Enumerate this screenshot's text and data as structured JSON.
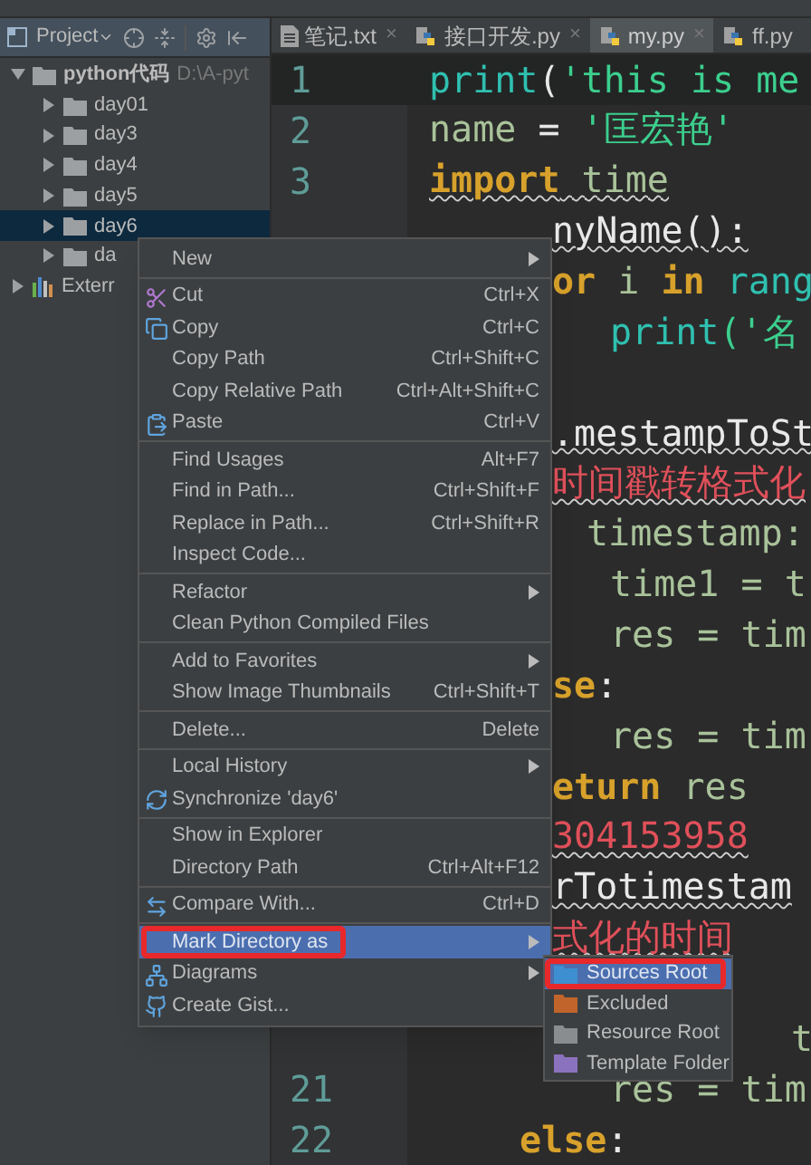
{
  "project_panel": {
    "title": "Project"
  },
  "tree": [
    {
      "label": "python代码",
      "path": "D:\\A-pyt",
      "expanded": true,
      "selected": false,
      "children": [
        {
          "label": "day01",
          "expanded": false,
          "selected": false
        },
        {
          "label": "day3",
          "expanded": false,
          "selected": false
        },
        {
          "label": "day4",
          "expanded": false,
          "selected": false
        },
        {
          "label": "day5",
          "expanded": false,
          "selected": false
        },
        {
          "label": "day6",
          "expanded": false,
          "selected": true
        },
        {
          "label": "da",
          "expanded": false,
          "selected": false
        }
      ]
    },
    {
      "label": "Exterr",
      "expanded": false,
      "selected": false,
      "kind": "libraries"
    }
  ],
  "tabs": [
    {
      "label": "笔记.txt",
      "close": "×",
      "selected": false,
      "kind": "text"
    },
    {
      "label": "接口开发.py",
      "close": "×",
      "selected": false,
      "kind": "python"
    },
    {
      "label": "my.py",
      "close": "×",
      "selected": true,
      "kind": "python"
    },
    {
      "label": "ff.py",
      "selected": false,
      "kind": "python"
    }
  ],
  "editor": {
    "lines": [
      {
        "number": "1",
        "squiggle": false,
        "segments": [
          {
            "text": "print",
            "kind": "fn"
          },
          {
            "text": "(",
            "kind": "op"
          },
          {
            "text": "'this is me",
            "kind": "str"
          }
        ]
      },
      {
        "number": "2",
        "squiggle": false,
        "segments": [
          {
            "text": "name ",
            "kind": "id"
          },
          {
            "text": "= ",
            "kind": "op"
          },
          {
            "text": "'匡宏艳'",
            "kind": "str"
          }
        ]
      },
      {
        "number": "3",
        "squiggle": true,
        "segments": [
          {
            "text": "import",
            "kind": "kw"
          },
          {
            "text": " time",
            "kind": "id"
          }
        ]
      },
      {
        "squiggle": true,
        "segments": [
          {
            "text": "nyName():",
            "kind": "op"
          }
        ]
      },
      {
        "squiggle": false,
        "segments": [
          {
            "text": "or ",
            "kind": "kw"
          },
          {
            "text": "i ",
            "kind": "id"
          },
          {
            "text": "in ",
            "kind": "kw"
          },
          {
            "text": "rang",
            "kind": "fn"
          }
        ]
      },
      {
        "squiggle": false,
        "segments": [
          {
            "text": "print",
            "kind": "fn"
          },
          {
            "text": "('名",
            "kind": "str"
          }
        ]
      },
      {
        "squiggle": true,
        "segments": [
          {
            "text": ".mestampToSt",
            "kind": "op"
          }
        ]
      },
      {
        "squiggle": true,
        "segments": [
          {
            "text": "时间戳转格式化",
            "kind": "err"
          }
        ]
      },
      {
        "squiggle": false,
        "segments": [
          {
            "text": "timestamp:",
            "kind": "id"
          }
        ]
      },
      {
        "squiggle": false,
        "segments": [
          {
            "text": "time1 = t",
            "kind": "id"
          }
        ]
      },
      {
        "squiggle": false,
        "segments": [
          {
            "text": "res = tim",
            "kind": "id"
          }
        ]
      },
      {
        "squiggle": false,
        "segments": [
          {
            "text": "se",
            "kind": "kw"
          },
          {
            "text": ":",
            "kind": "op"
          }
        ]
      },
      {
        "squiggle": false,
        "segments": [
          {
            "text": "res = tim",
            "kind": "id"
          }
        ]
      },
      {
        "squiggle": false,
        "segments": [
          {
            "text": "eturn ",
            "kind": "kw"
          },
          {
            "text": "res",
            "kind": "id"
          }
        ]
      },
      {
        "squiggle": true,
        "segments": [
          {
            "text": "304153958",
            "kind": "err"
          }
        ]
      },
      {
        "squiggle": true,
        "segments": [
          {
            "text": "rTotimestam",
            "kind": "op"
          }
        ]
      },
      {
        "squiggle": true,
        "segments": [
          {
            "text": "式化的时间",
            "kind": "err"
          }
        ]
      },
      {
        "squiggle": false,
        "segments": [
          {
            "text": "t",
            "kind": "id"
          }
        ]
      },
      {
        "number": "21",
        "squiggle": false,
        "segments": [
          {
            "text": "res = tim",
            "kind": "id"
          }
        ]
      },
      {
        "number": "22",
        "squiggle": false,
        "segments": [
          {
            "text": "else",
            "kind": "kw"
          },
          {
            "text": ":",
            "kind": "op"
          }
        ]
      }
    ]
  },
  "context_menu": {
    "groups": [
      [
        {
          "label": "New",
          "submenu": true,
          "selected": false,
          "highlighted": false
        }
      ],
      [
        {
          "label": "Cut",
          "shortcut": "Ctrl+X",
          "submenu": false,
          "selected": false,
          "highlighted": false
        },
        {
          "label": "Copy",
          "shortcut": "Ctrl+C",
          "submenu": false,
          "selected": false,
          "highlighted": false
        },
        {
          "label": "Copy Path",
          "shortcut": "Ctrl+Shift+C",
          "submenu": false,
          "selected": false,
          "highlighted": false
        },
        {
          "label": "Copy Relative Path",
          "shortcut": "Ctrl+Alt+Shift+C",
          "submenu": false,
          "selected": false,
          "highlighted": false
        },
        {
          "label": "Paste",
          "shortcut": "Ctrl+V",
          "submenu": false,
          "selected": false,
          "highlighted": false
        }
      ],
      [
        {
          "label": "Find Usages",
          "shortcut": "Alt+F7",
          "submenu": false,
          "selected": false,
          "highlighted": false
        },
        {
          "label": "Find in Path...",
          "shortcut": "Ctrl+Shift+F",
          "submenu": false,
          "selected": false,
          "highlighted": false
        },
        {
          "label": "Replace in Path...",
          "shortcut": "Ctrl+Shift+R",
          "submenu": false,
          "selected": false,
          "highlighted": false
        },
        {
          "label": "Inspect Code...",
          "submenu": false,
          "selected": false,
          "highlighted": false
        }
      ],
      [
        {
          "label": "Refactor",
          "submenu": true,
          "selected": false,
          "highlighted": false
        },
        {
          "label": "Clean Python Compiled Files",
          "submenu": false,
          "selected": false,
          "highlighted": false
        }
      ],
      [
        {
          "label": "Add to Favorites",
          "submenu": true,
          "selected": false,
          "highlighted": false
        },
        {
          "label": "Show Image Thumbnails",
          "shortcut": "Ctrl+Shift+T",
          "submenu": false,
          "selected": false,
          "highlighted": false
        }
      ],
      [
        {
          "label": "Delete...",
          "shortcut": "Delete",
          "submenu": false,
          "selected": false,
          "highlighted": false
        }
      ],
      [
        {
          "label": "Local History",
          "submenu": true,
          "selected": false,
          "highlighted": false
        },
        {
          "label": "Synchronize 'day6'",
          "submenu": false,
          "selected": false,
          "highlighted": false
        }
      ],
      [
        {
          "label": "Show in Explorer",
          "submenu": false,
          "selected": false,
          "highlighted": false
        },
        {
          "label": "Directory Path",
          "shortcut": "Ctrl+Alt+F12",
          "submenu": false,
          "selected": false,
          "highlighted": false
        }
      ],
      [
        {
          "label": "Compare With...",
          "shortcut": "Ctrl+D",
          "submenu": false,
          "selected": false,
          "highlighted": false
        }
      ],
      [
        {
          "label": "Mark Directory as",
          "submenu": true,
          "selected": true,
          "highlighted": true
        },
        {
          "label": "Diagrams",
          "submenu": true,
          "selected": false,
          "highlighted": false
        },
        {
          "label": "Create Gist...",
          "submenu": false,
          "selected": false,
          "highlighted": false
        }
      ]
    ]
  },
  "submenu": [
    {
      "label": "Sources Root",
      "selected": true,
      "highlighted": true,
      "color": "#3d8fd1"
    },
    {
      "label": "Excluded",
      "selected": false,
      "highlighted": false,
      "color": "#c1642b"
    },
    {
      "label": "Resource Root",
      "selected": false,
      "highlighted": false,
      "color": "#8a8d8f"
    },
    {
      "label": "Template Folder",
      "selected": false,
      "highlighted": false,
      "color": "#8b72bf"
    }
  ]
}
